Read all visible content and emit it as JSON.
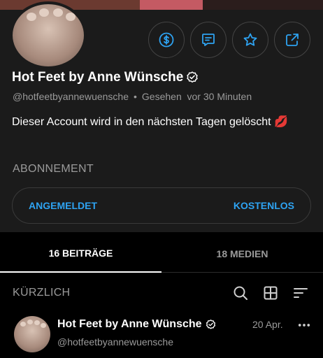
{
  "profile": {
    "name": "Hot Feet by Anne Wünsche",
    "handle": "@hotfeetbyannewuensche",
    "separator": "•",
    "seen_label": "Gesehen",
    "seen_time": "vor 30 Minuten",
    "bio": "Dieser Account wird in den nächsten Tagen gelöscht 💋"
  },
  "actions": {
    "tip_icon": "dollar-icon",
    "message_icon": "message-icon",
    "favorite_icon": "star-icon",
    "share_icon": "share-icon"
  },
  "subscription": {
    "section_label": "ABONNEMENT",
    "status": "ANGEMELDET",
    "price": "KOSTENLOS"
  },
  "tabs": [
    {
      "label": "16 BEITRÄGE",
      "active": true
    },
    {
      "label": "18 MEDIEN",
      "active": false
    }
  ],
  "feed": {
    "section_label": "KÜRZLICH",
    "tools": [
      "search-icon",
      "grid-icon",
      "sort-icon"
    ],
    "post": {
      "name": "Hot Feet by Anne Wünsche",
      "handle": "@hotfeetbyannewuensche",
      "date": "20 Apr."
    }
  },
  "colors": {
    "accent": "#2ea3f2",
    "background": "#000000",
    "panel": "#1b1b1b",
    "muted_text": "#9a9a9a"
  }
}
